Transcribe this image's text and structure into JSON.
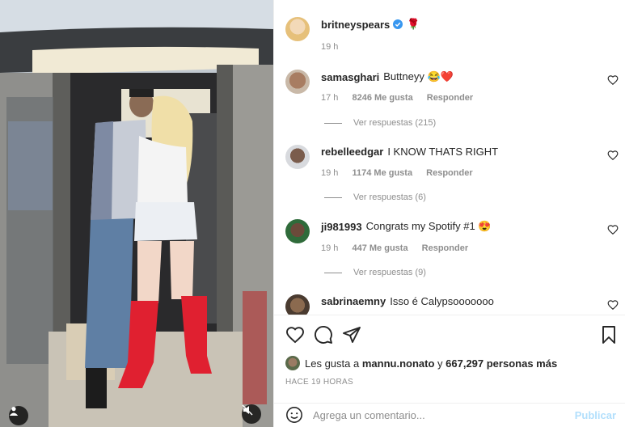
{
  "post": {
    "author": "britneyspears",
    "verified": true,
    "author_emoji": "🌹",
    "time": "19 h"
  },
  "comments": [
    {
      "user": "samasghari",
      "verified": false,
      "text": "Buttneyy 😂❤️",
      "time": "17 h",
      "likes": "8246 Me gusta",
      "reply": "Responder",
      "view_replies": "Ver respuestas (215)"
    },
    {
      "user": "rebelleedgar",
      "verified": false,
      "text": "I KNOW THATS RIGHT",
      "time": "19 h",
      "likes": "1174 Me gusta",
      "reply": "Responder",
      "view_replies": "Ver respuestas (6)"
    },
    {
      "user": "ji981993",
      "verified": false,
      "text": "Congrats my Spotify #1 😍",
      "time": "19 h",
      "likes": "447 Me gusta",
      "reply": "Responder",
      "view_replies": "Ver respuestas (9)"
    },
    {
      "user": "sabrinaemny",
      "verified": false,
      "text": "Isso é Calypsooooooo"
    }
  ],
  "likes_line": {
    "prefix": "Les gusta a",
    "first_user": "mannu.nonato",
    "connector": "y",
    "others": "667,297 personas más"
  },
  "post_time": "HACE 19 HORAS",
  "comment_box": {
    "placeholder": "Agrega un comentario...",
    "publish": "Publicar"
  },
  "icons": [
    "heart-icon",
    "comment-icon",
    "share-icon",
    "save-icon",
    "emoji-icon",
    "user-tag-icon",
    "mute-icon",
    "verified-icon"
  ],
  "colors": {
    "verified": "#3897f0",
    "boots": "#e02030",
    "publish": "#b2dffc"
  }
}
